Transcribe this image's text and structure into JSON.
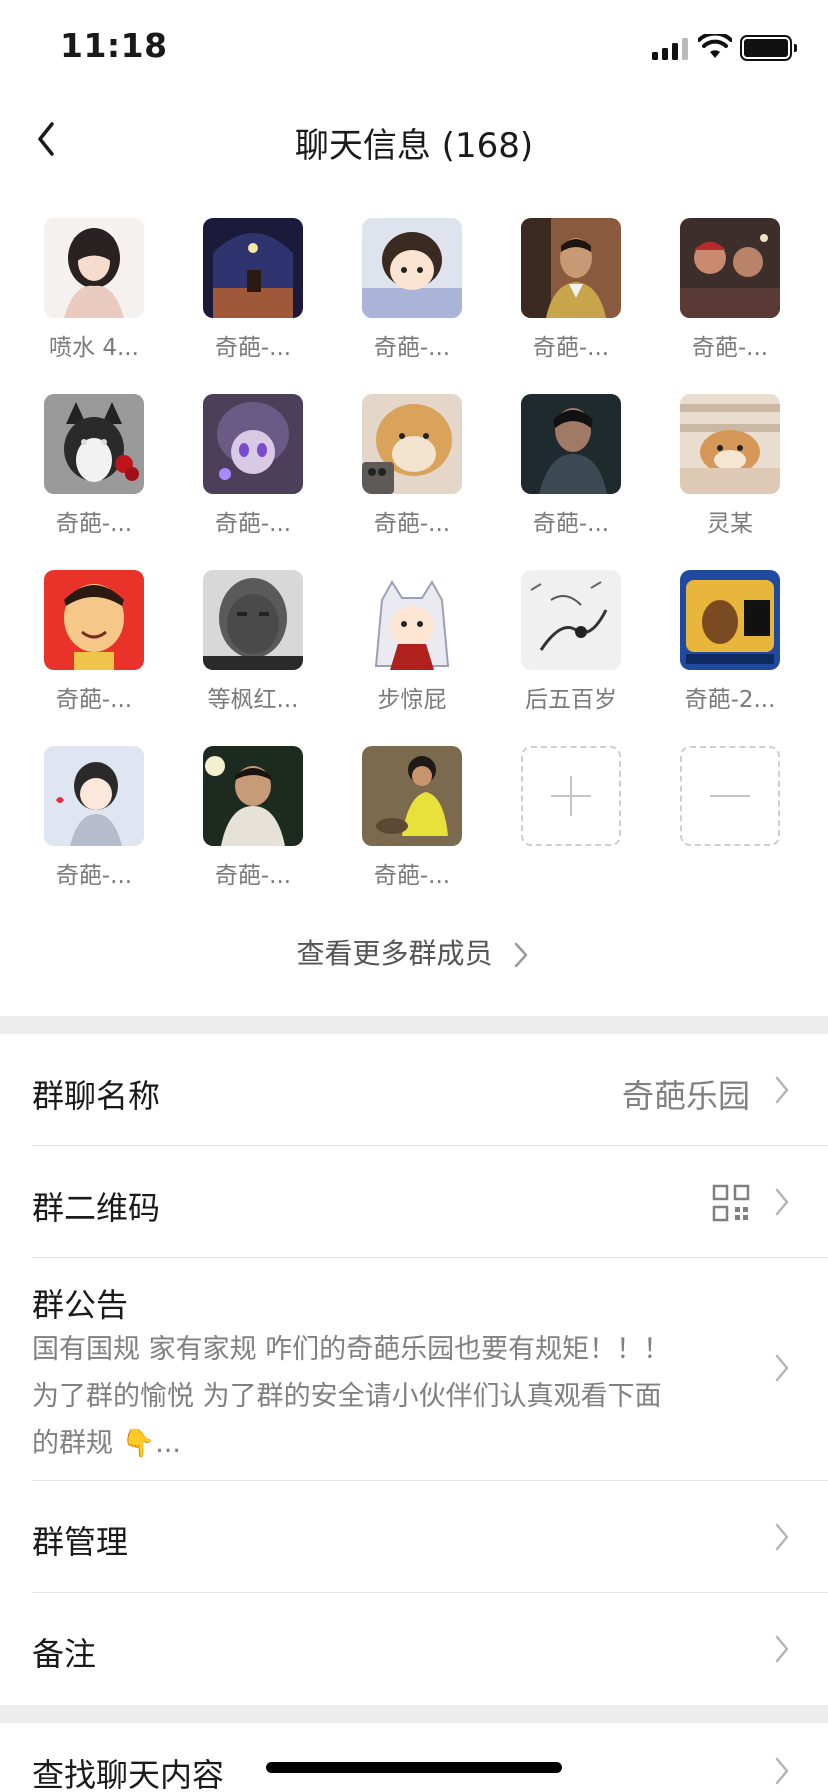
{
  "status_bar": {
    "time": "11:18"
  },
  "nav": {
    "title": "聊天信息 (168)"
  },
  "members": [
    {
      "name": "喷水 4...",
      "avatar": "anime-girl-avatar"
    },
    {
      "name": "奇葩-...",
      "avatar": "pixel-night-avatar"
    },
    {
      "name": "奇葩-...",
      "avatar": "cartoon-girl-avatar"
    },
    {
      "name": "奇葩-...",
      "avatar": "man-photo-avatar"
    },
    {
      "name": "奇葩-...",
      "avatar": "group-photo-avatar"
    },
    {
      "name": "奇葩-...",
      "avatar": "husky-rose-avatar"
    },
    {
      "name": "奇葩-...",
      "avatar": "purple-anime-avatar"
    },
    {
      "name": "奇葩-...",
      "avatar": "shiba-phone-avatar"
    },
    {
      "name": "奇葩-...",
      "avatar": "dark-man-avatar"
    },
    {
      "name": "灵某",
      "avatar": "shiba-blanket-avatar"
    },
    {
      "name": "奇葩-...",
      "avatar": "cartoon-face-avatar"
    },
    {
      "name": "等枫红...",
      "avatar": "bw-man-avatar"
    },
    {
      "name": "步惊屁",
      "avatar": "inuyasha-avatar"
    },
    {
      "name": "后五百岁",
      "avatar": "ink-painting-avatar"
    },
    {
      "name": "奇葩-2...",
      "avatar": "game-screen-avatar"
    },
    {
      "name": "奇葩-...",
      "avatar": "cartoon-boy-avatar"
    },
    {
      "name": "奇葩-...",
      "avatar": "night-boy-avatar"
    },
    {
      "name": "奇葩-...",
      "avatar": "kid-playing-avatar"
    }
  ],
  "add_button": {
    "symbol": "+"
  },
  "remove_button": {
    "symbol": "−"
  },
  "more_members": {
    "label": "查看更多群成员"
  },
  "rows": {
    "group_name": {
      "title": "群聊名称",
      "value": "奇葩乐园"
    },
    "qr_code": {
      "title": "群二维码"
    },
    "notice": {
      "title": "群公告",
      "line1": "国有国规 家有家规 咋们的奇葩乐园也要有规矩！！！",
      "line2": "为了群的愉悦 为了群的安全请小伙伴们认真观看下面",
      "line3": "的群规 👇..."
    },
    "manage": {
      "title": "群管理"
    },
    "remark": {
      "title": "备注"
    },
    "search": {
      "title": "查找聊天内容"
    }
  }
}
